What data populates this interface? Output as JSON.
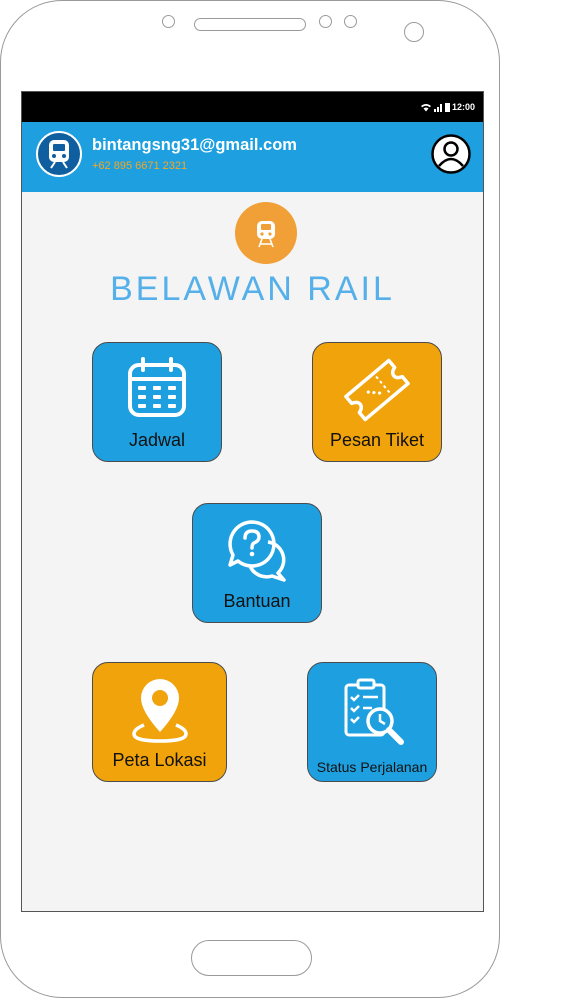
{
  "status_bar": {
    "time": "12:00"
  },
  "header": {
    "email": "bintangsng31@gmail.com",
    "phone": "+62 895 6671 2321"
  },
  "brand": {
    "name": "BELAWAN RAIL"
  },
  "menu": {
    "jadwal": "Jadwal",
    "pesan_tiket": "Pesan Tiket",
    "bantuan": "Bantuan",
    "peta_lokasi": "Peta Lokasi",
    "status_perjalanan": "Status Perjalanan"
  },
  "colors": {
    "primary_blue": "#1ea0e0",
    "accent_orange": "#f0a30a",
    "brand_text": "#55b0ea",
    "background": "#f4f4f4"
  },
  "icons": [
    "train-icon",
    "profile-icon",
    "calendar-icon",
    "ticket-icon",
    "help-chat-icon",
    "location-pin-icon",
    "search-document-icon"
  ]
}
